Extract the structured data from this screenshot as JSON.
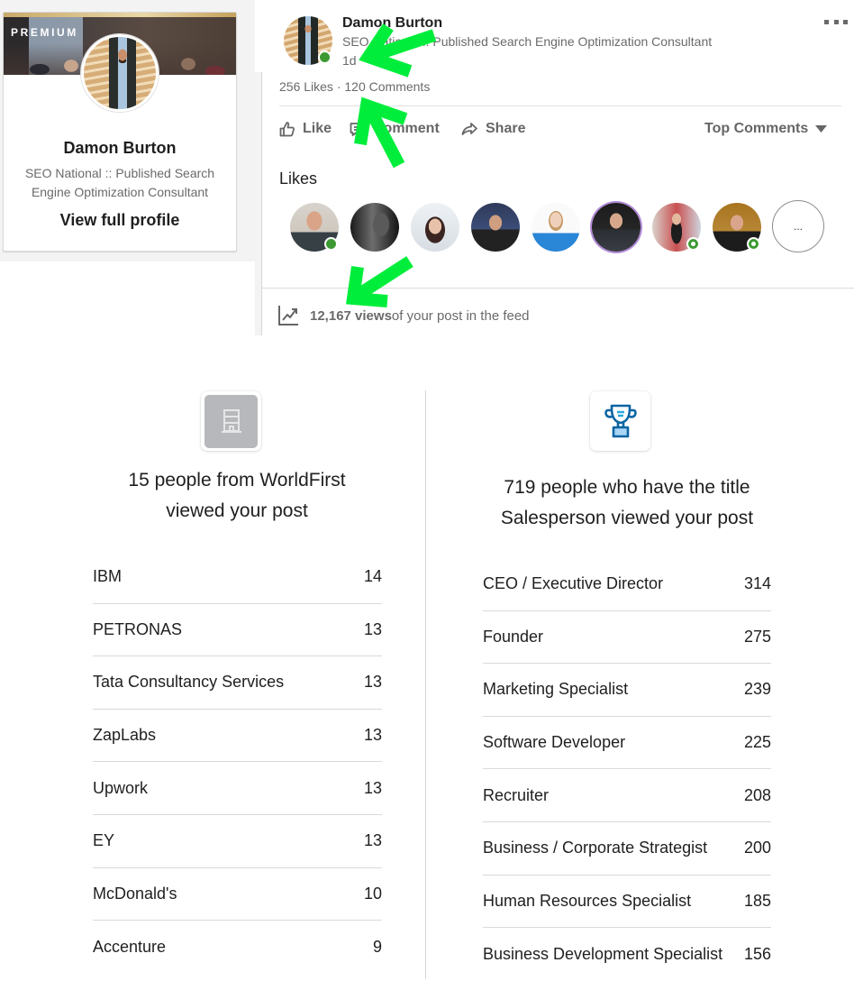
{
  "profile_card": {
    "badge": "PREMIUM",
    "name": "Damon Burton",
    "headline": "SEO National :: Published Search Engine Optimization Consultant",
    "view_profile": "View full profile"
  },
  "post": {
    "author": "Damon Burton",
    "headline": "SEO National :: Published Search Engine Optimization Consultant",
    "time": "1d",
    "likes_count": "256 Likes",
    "separator": " · ",
    "comments_count": "120 Comments",
    "actions": {
      "like": "Like",
      "comment": "Comment",
      "share": "Share"
    },
    "sort_label": "Top Comments",
    "likes_heading": "Likes",
    "likers": [
      {
        "presence": "active"
      },
      {
        "presence": "none"
      },
      {
        "presence": "none"
      },
      {
        "presence": "none"
      },
      {
        "presence": "none"
      },
      {
        "presence": "none",
        "ring_color": "#b48ad8"
      },
      {
        "presence": "reachable"
      },
      {
        "presence": "reachable"
      }
    ],
    "more_likers": "...",
    "views": {
      "count": "12,167 views",
      "suffix": " of your post in the feed"
    }
  },
  "insights": {
    "company": {
      "icon": "building-icon",
      "title": "15 people from WorldFirst viewed your post",
      "rows": [
        {
          "name": "IBM",
          "count": "14"
        },
        {
          "name": "PETRONAS",
          "count": "13"
        },
        {
          "name": "Tata Consultancy Services",
          "count": "13"
        },
        {
          "name": "ZapLabs",
          "count": "13"
        },
        {
          "name": "Upwork",
          "count": "13"
        },
        {
          "name": "EY",
          "count": "13"
        },
        {
          "name": "McDonald's",
          "count": "10"
        },
        {
          "name": "Accenture",
          "count": "9"
        }
      ]
    },
    "job_title": {
      "icon": "trophy-icon",
      "title": "719 people who have the title Salesperson viewed your post",
      "rows": [
        {
          "name": "CEO / Executive Director",
          "count": "314"
        },
        {
          "name": "Founder",
          "count": "275"
        },
        {
          "name": "Marketing Specialist",
          "count": "239"
        },
        {
          "name": "Software Developer",
          "count": "225"
        },
        {
          "name": "Recruiter",
          "count": "208"
        },
        {
          "name": "Business / Corporate Strategist",
          "count": "200"
        },
        {
          "name": "Human Resources Specialist",
          "count": "185"
        },
        {
          "name": "Business Development Specialist",
          "count": "156"
        }
      ]
    }
  },
  "colors": {
    "presence_green": "#3d9a32",
    "annotation_arrow": "#00ee3b",
    "trophy_blue": "#0b65a3"
  }
}
